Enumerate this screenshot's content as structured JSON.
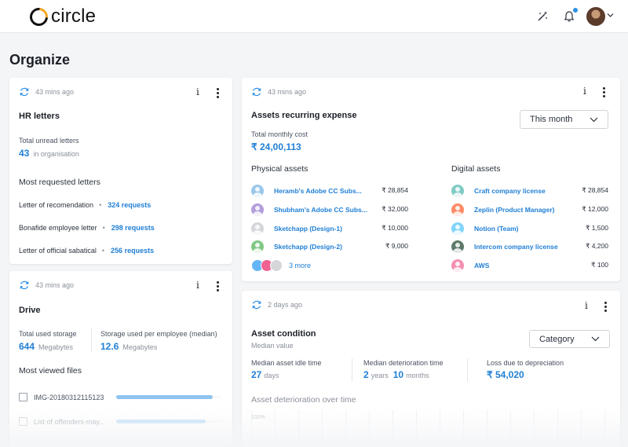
{
  "app": {
    "logo_text": "circle"
  },
  "page": {
    "title": "Organize"
  },
  "hr": {
    "time": "43 mins ago",
    "title": "HR letters",
    "unread_label": "Total unread letters",
    "unread_count": "43",
    "unread_suffix": "in organisation",
    "most_label": "Most requested letters",
    "letters": [
      {
        "name": "Letter of recomendation",
        "requests": "324 requests"
      },
      {
        "name": "Bonafide employee letter",
        "requests": "298 requests"
      },
      {
        "name": "Letter of official sabatical",
        "requests": "256 requests"
      }
    ]
  },
  "drive": {
    "time": "43 mins ago",
    "title": "Drive",
    "used_label": "Total used storage",
    "used_value": "644",
    "used_unit": "Megabytes",
    "per_emp_label": "Storage used per employee (median)",
    "per_emp_value": "12.6",
    "per_emp_unit": "Megabytes",
    "most_viewed_label": "Most viewed files",
    "files": [
      {
        "name": "IMG-20180312115123",
        "fraction": 0.92
      },
      {
        "name": "List of offenders-may...",
        "fraction": 0.85
      }
    ]
  },
  "assets": {
    "time": "43 mins ago",
    "title": "Assets recurring expense",
    "dropdown_value": "This month",
    "monthly_label": "Total monthly cost",
    "monthly_value": "₹ 24,00,113",
    "physical_label": "Physical assets",
    "digital_label": "Digital assets",
    "physical": [
      {
        "name": "Heramb's Adobe CC Subs...",
        "price": "₹ 28,854",
        "color": "#9ac7ea"
      },
      {
        "name": "Shubham's Adobe CC Subs...",
        "price": "₹ 32,000",
        "color": "#b39ddb"
      },
      {
        "name": "Sketchapp (Design-1)",
        "price": "₹ 10,000",
        "color": "#d5d7da"
      },
      {
        "name": "Sketchapp (Design-2)",
        "price": "₹ 9,000",
        "color": "#81c784"
      }
    ],
    "digital": [
      {
        "name": "Craft company license",
        "price": "₹ 28,854",
        "color": "#80cbc4"
      },
      {
        "name": "Zeplin (Product Manager)",
        "price": "₹ 12,000",
        "color": "#ff8a65"
      },
      {
        "name": "Notion (Team)",
        "price": "₹ 1,500",
        "color": "#81d4fa"
      },
      {
        "name": "Intercom company license",
        "price": "₹ 4,200",
        "color": "#5d7a6a"
      },
      {
        "name": "AWS",
        "price": "₹ 100",
        "color": "#f48fb1"
      }
    ],
    "more_label": "3 more",
    "stack_colors": [
      "#64b5f6",
      "#f06292",
      "#d5d7da"
    ]
  },
  "condition": {
    "time": "2 days ago",
    "title": "Asset condition",
    "subtitle": "Median value",
    "dropdown_value": "Category",
    "idle_label": "Median asset idle time",
    "idle_value": "27",
    "idle_unit": "days",
    "deter_label": "Median deterioration time",
    "deter_years": "2",
    "deter_years_unit": "years",
    "deter_months": "10",
    "deter_months_unit": "months",
    "loss_label": "Loss due to depreciation",
    "loss_value": "₹ 54,020",
    "over_time_label": "Asset deterioration over time",
    "axis_top": "100%"
  },
  "icon_names": [
    "magic-wand-icon",
    "bell-icon",
    "refresh-icon",
    "info-icon",
    "kebab-menu-icon",
    "chevron-down-icon",
    "image-file-icon"
  ],
  "colors": {
    "accent": "#1f7fd6",
    "logo_accent": "#f5a623",
    "notif": "#2d8fe3"
  }
}
